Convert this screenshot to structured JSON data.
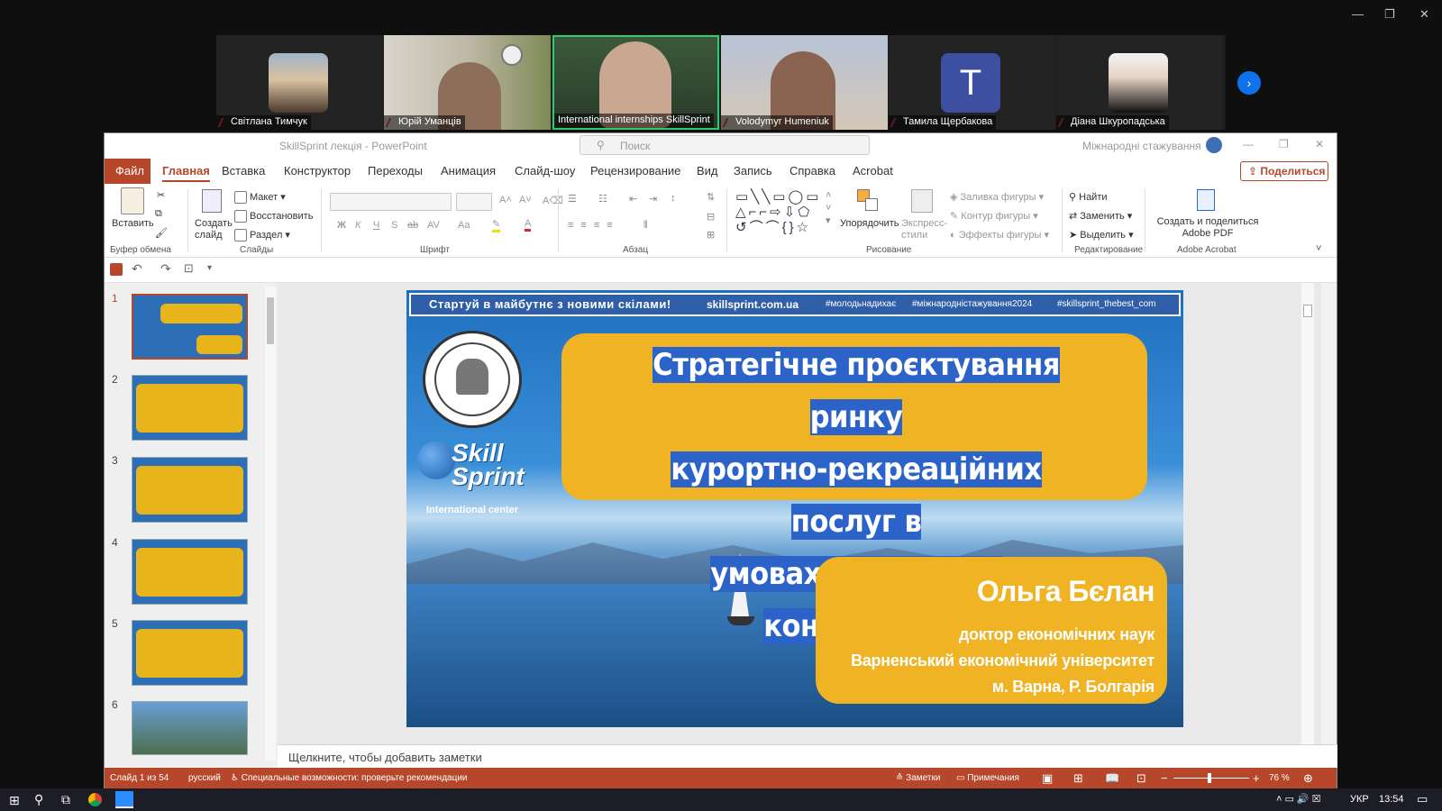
{
  "participants": [
    {
      "name": "Світлана Тимчук"
    },
    {
      "name": "Юрій Уманців"
    },
    {
      "name": "International internships SkillSprint"
    },
    {
      "name": "Volodymyr Humeniuk"
    },
    {
      "name": "Тамила Щербакова",
      "initial": "T"
    },
    {
      "name": "Діана Шкуропадська"
    }
  ],
  "window": {
    "title": "SkillSprint лекція  -  PowerPoint",
    "search_placeholder": "Поиск",
    "account": "Міжнародні стажування"
  },
  "tabs": [
    "Файл",
    "Главная",
    "Вставка",
    "Конструктор",
    "Переходы",
    "Анимация",
    "Слайд-шоу",
    "Рецензирование",
    "Вид",
    "Запись",
    "Справка",
    "Acrobat"
  ],
  "share_label": "Поделиться",
  "ribbon": {
    "paste": "Вставить",
    "new_slide": "Создать слайд",
    "layout": "Макет",
    "reset": "Восстановить",
    "section": "Раздел",
    "arrange": "Упорядочить",
    "quick_styles": "Экспресс-стили",
    "shape_fill": "Заливка фигуры",
    "shape_outline": "Контур фигуры",
    "shape_effects": "Эффекты фигуры",
    "find": "Найти",
    "replace": "Заменить",
    "select": "Выделить",
    "adobe": "Создать и поделиться Adobe PDF",
    "fmt": [
      "Ж",
      "К",
      "Ч",
      "S",
      "ab",
      "AV",
      "Aa"
    ],
    "groups": [
      "Буфер обмена",
      "Слайды",
      "Шрифт",
      "Абзац",
      "Рисование",
      "Редактирование",
      "Adobe Acrobat"
    ]
  },
  "slide": {
    "banner": [
      "Стартуй в майбутнє з новими скілами!",
      "skillsprint.com.ua",
      "#молодьнадихає",
      "#міжнароднiстажування2024",
      "#skillsprint_thebest_com"
    ],
    "title_lines": [
      "Стратегічне проєктування ринку",
      "курортно-рекреаційних послуг в",
      "умовах глобальної конкуренції"
    ],
    "speaker": "Ольга Бєлан",
    "speaker_info": [
      "доктор економічних наук",
      "Варненський економічний університет",
      "м. Варна, Р. Болгарія"
    ],
    "logo_brand": "Skill Sprint",
    "logo_sub": "International center"
  },
  "thumbs": [
    "1",
    "2",
    "3",
    "4",
    "5",
    "6"
  ],
  "notes_placeholder": "Щелкните, чтобы добавить заметки",
  "status": {
    "slide_count": "Слайд 1 из 54",
    "language": "русский",
    "accessibility": "Специальные возможности: проверьте рекомендации",
    "notes": "Заметки",
    "comments": "Примечания",
    "zoom": "76 %"
  },
  "taskbar": {
    "lang": "УКР",
    "time": "13:54"
  }
}
